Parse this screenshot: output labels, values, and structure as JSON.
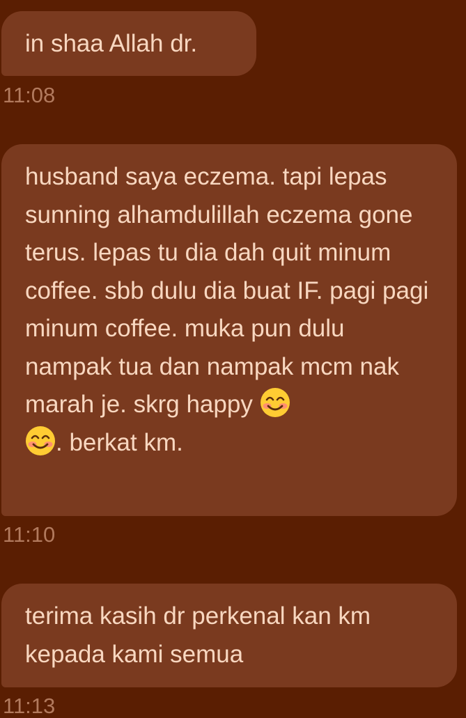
{
  "messages": [
    {
      "text": "in shaa Allah dr.",
      "time": "11:08"
    },
    {
      "text_part1": "husband saya eczema. tapi lepas sunning alhamdulillah eczema gone terus. lepas tu dia dah quit minum coffee. sbb dulu dia buat IF. pagi pagi minum coffee. muka pun dulu nampak tua dan nampak mcm nak marah je. skrg happy ",
      "emoji": "smiling-face-with-smiling-eyes",
      "text_part2": ". berkat km.",
      "time": "11:10"
    },
    {
      "text": "terima kasih dr perkenal kan km kepada kami semua",
      "time": "11:13"
    }
  ],
  "colors": {
    "background": "#5a1e02",
    "bubble": "#7a3a1f",
    "text": "#f8d7c0",
    "timestamp": "#b27a5e"
  }
}
